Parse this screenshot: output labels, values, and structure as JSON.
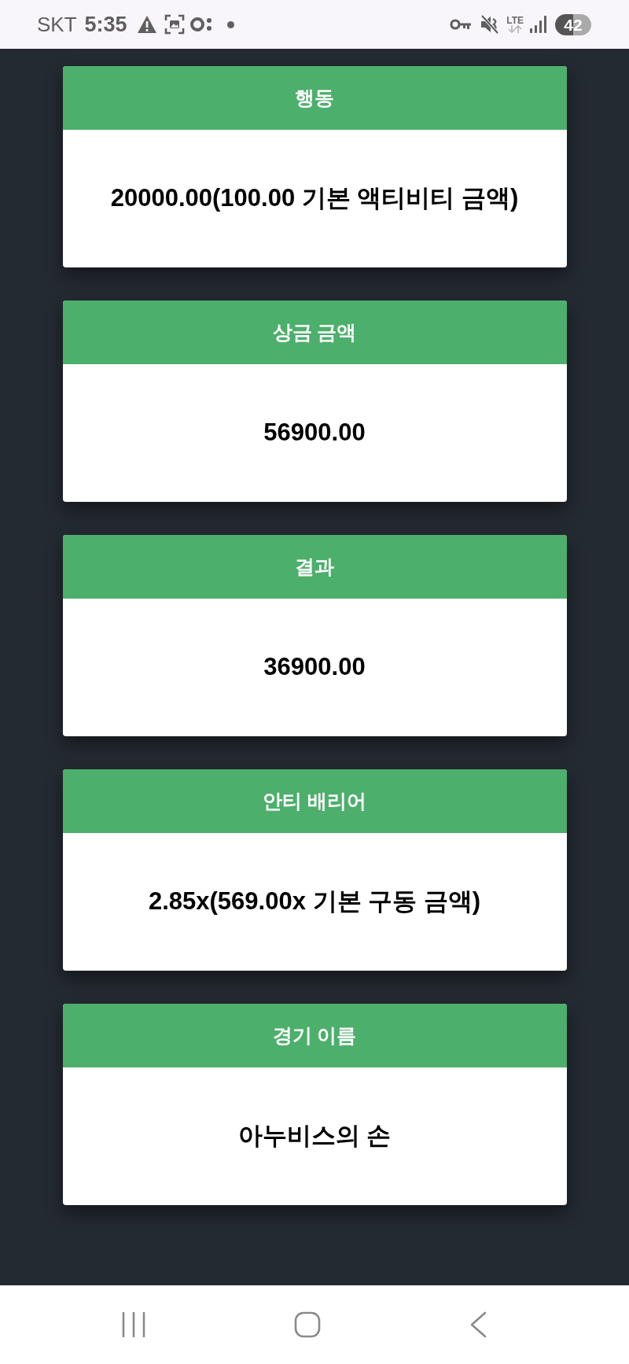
{
  "status_bar": {
    "carrier": "SKT",
    "time": "5:35",
    "network": "LTE",
    "battery": "42"
  },
  "cards": [
    {
      "title": "행동",
      "value": "20000.00(100.00 기본 액티비티 금액)"
    },
    {
      "title": "상금 금액",
      "value": "56900.00"
    },
    {
      "title": "결과",
      "value": "36900.00"
    },
    {
      "title": "안티 배리어",
      "value": "2.85x(569.00x 기본 구동 금액)"
    },
    {
      "title": "경기 이름",
      "value": "아누비스의 손"
    }
  ]
}
